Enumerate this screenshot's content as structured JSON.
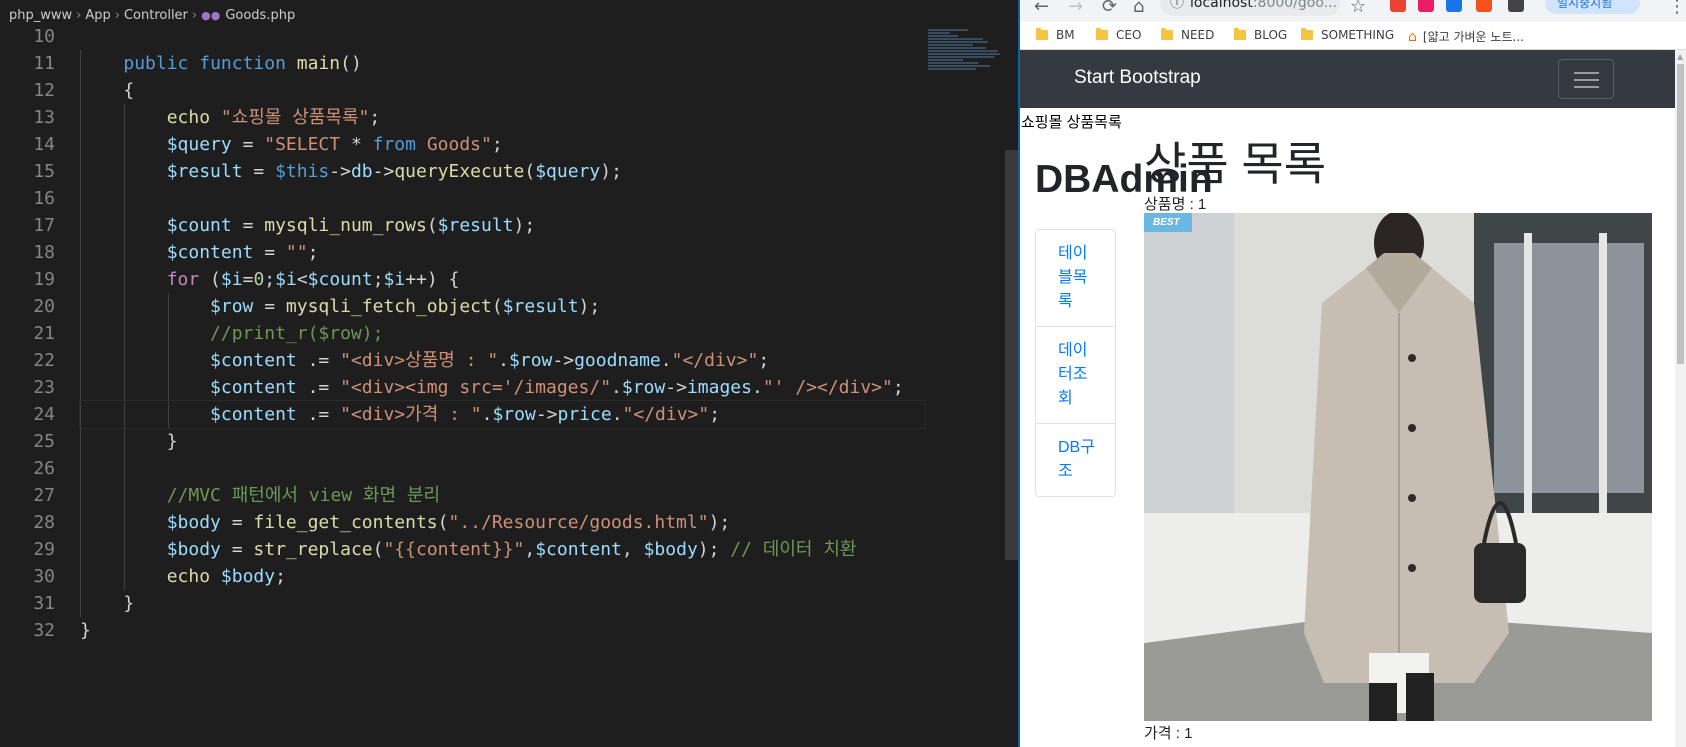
{
  "editor": {
    "breadcrumb": [
      "php_www",
      "App",
      "Controller",
      "Goods.php"
    ],
    "line_numbers": [
      "10",
      "11",
      "12",
      "13",
      "14",
      "15",
      "16",
      "17",
      "18",
      "19",
      "20",
      "21",
      "22",
      "23",
      "24",
      "25",
      "26",
      "27",
      "28",
      "29",
      "30",
      "31",
      "32"
    ],
    "code": {
      "l11": [
        "public",
        "function",
        "main",
        "()"
      ],
      "l12": [
        "{"
      ],
      "l13": [
        "echo",
        "\"쇼핑몰 상품목록\"",
        ";"
      ],
      "l14": [
        "$query",
        " = ",
        "\"SELECT ",
        "*",
        " from ",
        "Goods\"",
        ";"
      ],
      "l15": [
        "$result",
        " = ",
        "$this",
        "->",
        "db",
        "->",
        "queryExecute",
        "(",
        "$query",
        ");"
      ],
      "l17": [
        "$count",
        " = ",
        "mysqli_num_rows",
        "(",
        "$result",
        ");"
      ],
      "l18": [
        "$content",
        " = ",
        "\"\"",
        ";"
      ],
      "l19": [
        "for",
        " (",
        "$i",
        "=",
        "0",
        ";",
        "$i",
        "<",
        "$count",
        ";",
        "$i",
        "++) {"
      ],
      "l20": [
        "$row",
        " = ",
        "mysqli_fetch_object",
        "(",
        "$result",
        ");"
      ],
      "l21": [
        "//print_r($row);"
      ],
      "l22": [
        "$content",
        " .= ",
        "\"<div>상품명 : \"",
        ".",
        "$row",
        "->",
        "goodname",
        ".",
        "\"</div>\"",
        ";"
      ],
      "l23": [
        "$content",
        " .= ",
        "\"<div><img src='/images/\"",
        ".",
        "$row",
        "->",
        "images",
        ".",
        "\"' /></div>\"",
        ";"
      ],
      "l24": [
        "$content",
        " .= ",
        "\"<div>가격 : \"",
        ".",
        "$row",
        "->",
        "price",
        ".",
        "\"</div>\"",
        ";"
      ],
      "l25": [
        "}"
      ],
      "l27": [
        "//MVC 패턴에서 view 화면 분리"
      ],
      "l28": [
        "$body",
        " = ",
        "file_get_contents",
        "(",
        "\"../Resource/goods.html\"",
        ");"
      ],
      "l29": [
        "$body",
        " = ",
        "str_replace",
        "(",
        "\"{{content}}\"",
        ",",
        "$content",
        ", ",
        "$body",
        "); ",
        "// 데이터 치환"
      ],
      "l30": [
        "echo",
        " ",
        "$body",
        ";"
      ],
      "l31": [
        "}"
      ],
      "l32": [
        "}"
      ]
    }
  },
  "browser": {
    "url_host": "localhost",
    "url_rest": ":8000/goo...",
    "sync_label": "일시중지됨",
    "bookmarks": [
      "BM",
      "CEO",
      "NEED",
      "BLOG",
      "SOMETHING",
      "[얇고 가벼운 노트..."
    ],
    "brand": "Start Bootstrap",
    "echo_text": "쇼핑몰 상품목록",
    "sidebar_title": "DBAdmin",
    "menu": [
      "테이블목록",
      "데이터조회",
      "DB구조"
    ],
    "goods_title": "상품 목록",
    "goods_name": "상품명 : 1",
    "badge": "BEST",
    "goods_price": "가격 : 1"
  },
  "icons": {
    "back": "arrow-left-icon",
    "forward": "arrow-right-icon",
    "reload": "reload-icon",
    "home": "home-icon",
    "info": "info-icon",
    "star": "star-icon",
    "menu": "menu-dots-icon",
    "php": "php-icon",
    "folder": "folder-icon",
    "hamburger": "hamburger-icon"
  },
  "colors": {
    "editor_bg": "#1e1e1e",
    "navbar_bg": "#343a40",
    "link": "#007bff",
    "badge_bg": "#6ab8e0"
  }
}
